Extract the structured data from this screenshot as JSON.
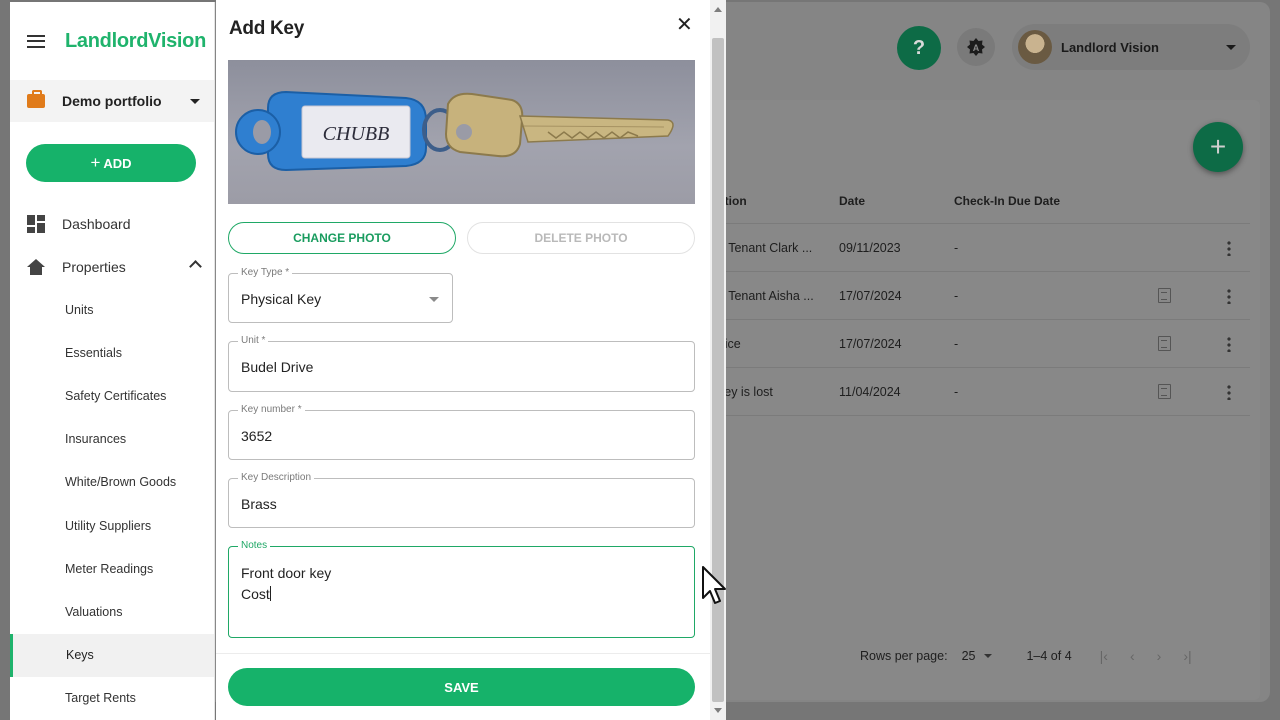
{
  "background": {
    "header": {
      "help_glyph": "?",
      "theme_glyph": "A",
      "user_name": "Landlord Vision"
    },
    "table": {
      "columns": [
        "ation",
        "Date",
        "Check-In Due Date"
      ],
      "rows": [
        {
          "location": "n Tenant Clark ...",
          "date": "09/11/2023",
          "checkin_due": "-",
          "has_doc": false
        },
        {
          "location": "n Tenant Aisha ...",
          "date": "17/07/2024",
          "checkin_due": "-",
          "has_doc": true
        },
        {
          "location": "ffice",
          "date": "17/07/2024",
          "checkin_due": "-",
          "has_doc": true
        },
        {
          "location": "key is lost",
          "date": "11/04/2024",
          "checkin_due": "-",
          "has_doc": true
        }
      ]
    },
    "pagination": {
      "rows_per_page_label": "Rows per page:",
      "rows_per_page_value": "25",
      "range": "1–4 of 4"
    }
  },
  "sidebar": {
    "logo": "LandlordVision",
    "portfolio": "Demo portfolio",
    "add_label": "ADD",
    "nav": [
      {
        "label": "Dashboard",
        "icon": "dashboard-icon"
      },
      {
        "label": "Properties",
        "icon": "home-icon",
        "expanded": true
      }
    ],
    "sub_items": [
      {
        "label": "Units",
        "active": false
      },
      {
        "label": "Essentials",
        "active": false
      },
      {
        "label": "Safety Certificates",
        "active": false
      },
      {
        "label": "Insurances",
        "active": false
      },
      {
        "label": "White/Brown Goods",
        "active": false
      },
      {
        "label": "Utility Suppliers",
        "active": false
      },
      {
        "label": "Meter Readings",
        "active": false
      },
      {
        "label": "Valuations",
        "active": false
      },
      {
        "label": "Keys",
        "active": true
      },
      {
        "label": "Target Rents",
        "active": false
      }
    ]
  },
  "dialog": {
    "title": "Add Key",
    "close_glyph": "✕",
    "photo_key_tag_text": "CHUBB",
    "change_photo_label": "CHANGE PHOTO",
    "delete_photo_label": "DELETE PHOTO",
    "fields": {
      "key_type": {
        "label": "Key Type *",
        "value": "Physical Key"
      },
      "unit": {
        "label": "Unit *",
        "value": "Budel Drive"
      },
      "key_number": {
        "label": "Key number *",
        "value": "3652"
      },
      "key_description": {
        "label": "Key Description",
        "value": "Brass"
      },
      "notes": {
        "label": "Notes",
        "line1": "Front door key",
        "line2": "Cost"
      }
    },
    "save_label": "SAVE"
  },
  "colors": {
    "brand_green": "#16b26a",
    "dark_green_overlay": "#0d6b46",
    "accent_orange": "#e07b1a"
  }
}
